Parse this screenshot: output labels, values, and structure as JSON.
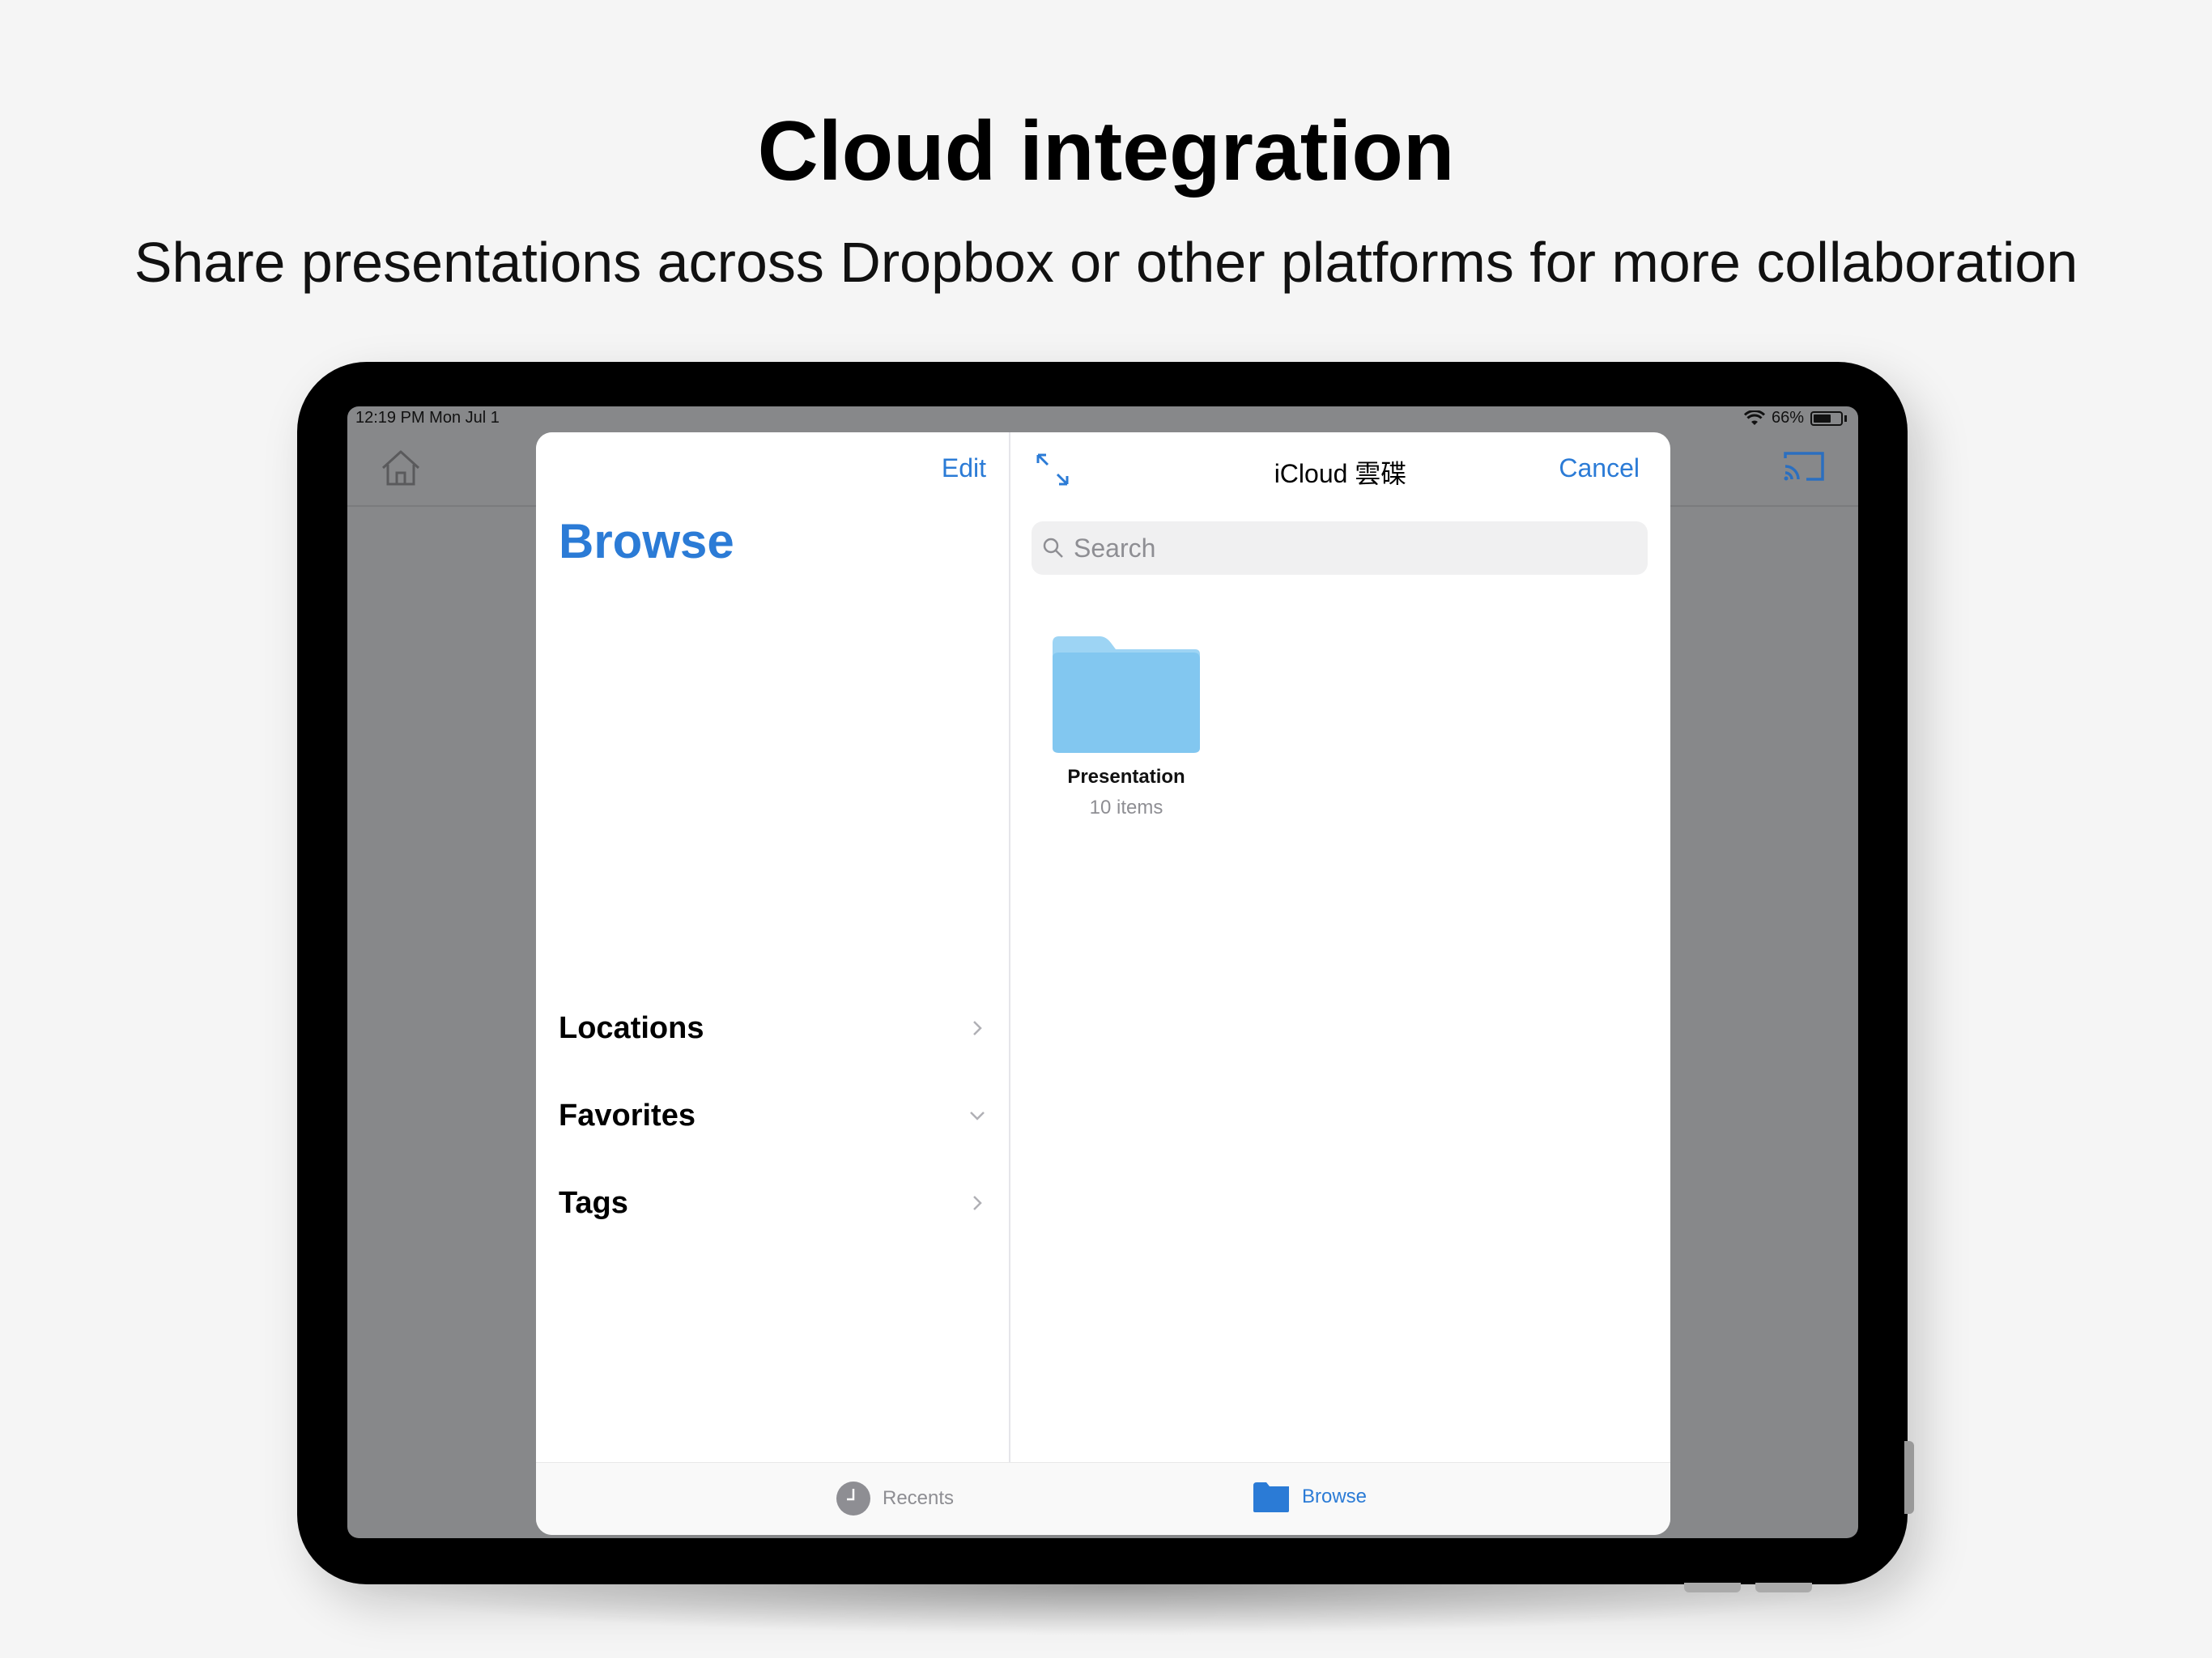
{
  "marketing": {
    "headline": "Cloud integration",
    "subheadline": "Share presentations across Dropbox or other platforms for more collaboration"
  },
  "statusbar": {
    "time": "12:19 PM   Mon Jul 1",
    "battery": "66%",
    "battery_level": 0.66,
    "icons": [
      "wifi-icon",
      "battery-icon"
    ]
  },
  "app_toolbar": {
    "icons": [
      "home-icon",
      "cast-icon"
    ]
  },
  "sidebar": {
    "edit_label": "Edit",
    "title": "Browse",
    "items": [
      {
        "label": "Locations",
        "icon": "chevron-right-icon"
      },
      {
        "label": "Favorites",
        "icon": "chevron-down-icon"
      },
      {
        "label": "Tags",
        "icon": "chevron-right-icon"
      }
    ]
  },
  "main": {
    "title": "iCloud 雲碟",
    "cancel_label": "Cancel",
    "search": {
      "placeholder": "Search",
      "value": ""
    },
    "items": [
      {
        "name": "Presentation",
        "count": "10 items",
        "icon": "folder-icon"
      }
    ]
  },
  "tabbar": {
    "tabs": [
      {
        "label": "Recents",
        "icon": "clock-icon",
        "selected": false
      },
      {
        "label": "Browse",
        "icon": "folder-icon",
        "selected": true
      }
    ]
  },
  "colors": {
    "accent": "#2b7bd6",
    "screen_dim": "#87888a",
    "folder": "#82c7f0"
  }
}
